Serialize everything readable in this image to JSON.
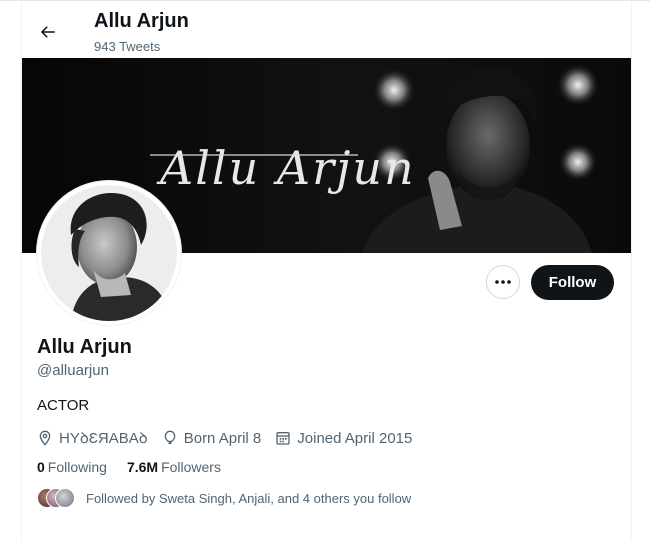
{
  "header": {
    "title": "Allu Arjun",
    "tweet_count": "943 Tweets"
  },
  "banner": {
    "script_text": "Allu Arjun"
  },
  "actions": {
    "more_label": "More",
    "follow_label": "Follow"
  },
  "profile": {
    "name": "Allu Arjun",
    "handle": "@alluarjun",
    "bio": "ACTOR",
    "location": "HYꝺƐЯABAꝺ",
    "birthday": "Born April 8",
    "joined": "Joined April 2015",
    "following_count": "0",
    "following_label": "Following",
    "followers_count": "7.6M",
    "followers_label": "Followers",
    "followed_by": "Followed by Sweta Singh, Anjali, and 4 others you follow"
  },
  "icons": {
    "back": "arrow-left-icon",
    "more": "ellipsis-icon",
    "location": "location-pin-icon",
    "birthday": "balloon-icon",
    "joined": "calendar-icon"
  },
  "colors": {
    "button_dark": "#0f1419",
    "secondary_text": "#536471",
    "border": "#cfd9de"
  }
}
